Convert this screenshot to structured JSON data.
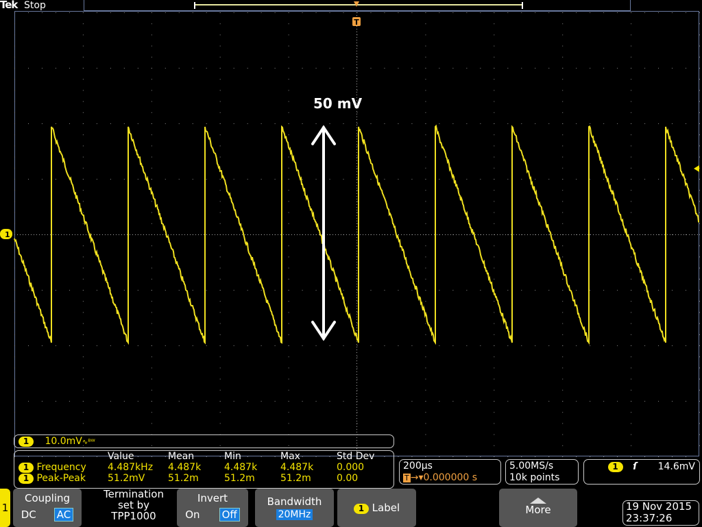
{
  "header": {
    "brand": "Tek",
    "acq_state": "Stop"
  },
  "trigger_marker": "T",
  "overlay": {
    "annotation": "50 mV"
  },
  "channel": {
    "number": "1",
    "scale": "10.0mV",
    "bw_symbol": "∿ᴮᵂ",
    "color": "#f5e400"
  },
  "measurements": {
    "headers": [
      "",
      "Value",
      "Mean",
      "Min",
      "Max",
      "Std Dev"
    ],
    "rows": [
      {
        "ch": "1",
        "name": "Frequency",
        "value": "4.487kHz",
        "mean": "4.487k",
        "min": "4.487k",
        "max": "4.487k",
        "std": "0.000"
      },
      {
        "ch": "1",
        "name": "Peak-Peak",
        "value": "51.2mV",
        "mean": "51.2m",
        "min": "51.2m",
        "max": "51.2m",
        "std": "0.00"
      }
    ]
  },
  "timebase": {
    "scale": "200µs",
    "trig_icon": "T",
    "delay": "→▾0.000000 s"
  },
  "acquisition": {
    "rate": "5.00MS/s",
    "length": "10k points"
  },
  "trigger": {
    "ch": "1",
    "slope": "rising-edge",
    "level": "14.6mV"
  },
  "menu": {
    "channel_tab": "1",
    "coupling": {
      "label": "Coupling",
      "opt1": "DC",
      "opt2": "AC",
      "selected": "AC"
    },
    "termination": {
      "line1": "Termination",
      "line2": "set by",
      "line3": "TPP1000"
    },
    "invert": {
      "label": "Invert",
      "opt1": "On",
      "opt2": "Off",
      "selected": "Off"
    },
    "bandwidth": {
      "label": "Bandwidth",
      "value": "20MHz"
    },
    "label": {
      "ch": "1",
      "text": "Label"
    },
    "more": "More"
  },
  "datetime": {
    "date": "19 Nov 2015",
    "time": "23:37:26"
  }
}
